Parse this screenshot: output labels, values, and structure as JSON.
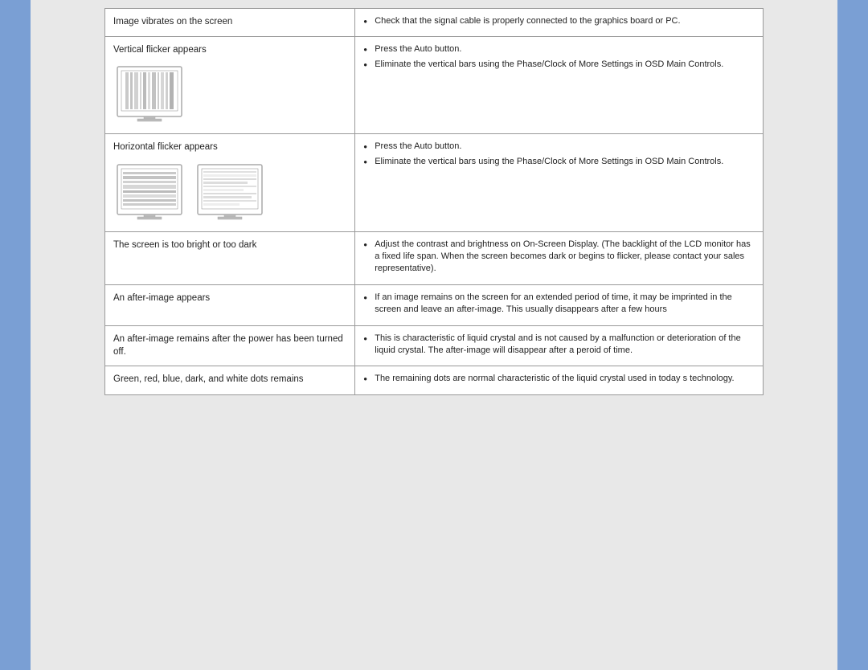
{
  "table": {
    "rows": [
      {
        "id": "image-vibrates",
        "symptom": "Image vibrates on the screen",
        "solutions": [
          "Check that the signal cable is properly connected to the graphics board or PC."
        ],
        "has_image": false
      },
      {
        "id": "vertical-flicker",
        "symptom": "Vertical flicker appears",
        "solutions": [
          "Press the Auto button.",
          "Eliminate the vertical bars using the Phase/Clock of More Settings in OSD Main Controls."
        ],
        "has_image": true,
        "image_type": "vertical"
      },
      {
        "id": "horizontal-flicker",
        "symptom": "Horizontal flicker appears",
        "solutions": [
          "Press the Auto button.",
          "Eliminate the vertical bars using the Phase/Clock of More Settings in OSD Main Controls."
        ],
        "has_image": true,
        "image_type": "horizontal"
      },
      {
        "id": "too-bright-dark",
        "symptom": "The screen is too bright or too dark",
        "solutions": [
          "Adjust the contrast and brightness on On-Screen Display. (The backlight of the LCD monitor has a fixed life span. When the screen becomes dark or begins to flicker, please contact your sales representative)."
        ],
        "has_image": false
      },
      {
        "id": "after-image",
        "symptom": "An after-image appears",
        "solutions": [
          "If an image remains on the screen for an extended period of time, it may be imprinted in the screen and leave an after-image. This usually disappears after a few hours"
        ],
        "has_image": false
      },
      {
        "id": "after-image-power",
        "symptom": "An after-image remains after the power has been turned off.",
        "solutions": [
          "This is characteristic of liquid crystal and is not caused by a malfunction or deterioration of the liquid crystal. The after-image will disappear after a peroid of time."
        ],
        "has_image": false
      },
      {
        "id": "green-red-blue",
        "symptom": "Green, red, blue, dark, and white dots remains",
        "solutions": [
          "The remaining dots are normal characteristic of the liquid crystal used in today s technology."
        ],
        "has_image": false
      }
    ]
  }
}
